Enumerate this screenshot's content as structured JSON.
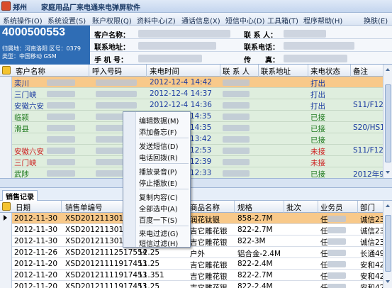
{
  "window": {
    "title": "郑州　　家庭用品厂来电通来电弹屏软件"
  },
  "menu": [
    "系统操作(O)",
    "系统设置(S)",
    "账户权限(Q)",
    "资料中心(Z)",
    "通话信息(X)",
    "短信中心(D)",
    "工具箱(T)",
    "程序帮助(H)",
    "换肤(E)"
  ],
  "caller": {
    "number": "4000500553",
    "location_label": "归属地：",
    "location": "河南洛阳",
    "area_label": "区号：",
    "area_code": "0379",
    "type_label": "类型：",
    "type": "中国移动 GSM"
  },
  "fields": {
    "customer_name": "客户名称：",
    "contact": "联 系 人：",
    "contact_address": "联系地址：",
    "contact_phone": "联系电话：",
    "mobile": "手 机 号：",
    "fax": "传　　真："
  },
  "top_columns": [
    "客户名称",
    "呼入号码",
    "来电时间",
    "联 系 人",
    "联系地址",
    "来电状态",
    "备注"
  ],
  "calls": [
    {
      "name": "栾川",
      "time": "2012-12-4 14:42",
      "status": "打出",
      "note": "",
      "name_color": "blue",
      "status_color": "blue",
      "selected": true
    },
    {
      "name": "三门峡",
      "time": "2012-12-4 14:37",
      "status": "打出",
      "note": "",
      "name_color": "blue",
      "status_color": "blue",
      "selected": false
    },
    {
      "name": "安徽六安",
      "time": "2012-12-4 14:36",
      "status": "打出",
      "note": "S11/F120",
      "name_color": "blue",
      "status_color": "blue",
      "selected": false
    },
    {
      "name": "临颍",
      "time": "14:35",
      "status": "已接",
      "note": "",
      "name_color": "green",
      "status_color": "green",
      "selected": false
    },
    {
      "name": "滑县",
      "time": "14:35",
      "status": "已接",
      "note": "S20/HS14",
      "name_color": "green",
      "status_color": "green",
      "selected": false
    },
    {
      "name": "",
      "time": "13:42",
      "status": "已接",
      "note": "",
      "name_color": "green",
      "status_color": "green",
      "selected": false
    },
    {
      "name": "安徽六安",
      "time": "12:53",
      "status": "未接",
      "note": "S11/F120",
      "name_color": "red",
      "status_color": "red",
      "selected": false
    },
    {
      "name": "三门峡",
      "time": "12:39",
      "status": "未接",
      "note": "",
      "name_color": "red",
      "status_color": "red",
      "selected": false
    },
    {
      "name": "武陟",
      "time": "12:33",
      "status": "已接",
      "note": "2012年9",
      "name_color": "green",
      "status_color": "green",
      "selected": false
    }
  ],
  "tab": {
    "label": "销售记录"
  },
  "sales_columns": [
    "日期",
    "销售单编号",
    "",
    "商品名称",
    "规格",
    "批次",
    "业务员",
    "部门"
  ],
  "sales": [
    {
      "date": "2012-11-30",
      "no": "XSD20121130176",
      "qty": "",
      "product": "润花钛银",
      "spec": "858-2.7M",
      "clerk": "任",
      "dept": "诚信23",
      "selected": true
    },
    {
      "date": "2012-11-30",
      "no": "XSD20121130176",
      "qty": "",
      "product": "吉它雕花银",
      "spec": "822-2.7M",
      "clerk": "任",
      "dept": "诚信23",
      "selected": false
    },
    {
      "date": "2012-11-30",
      "no": "XSD20121130176",
      "qty": "",
      "product": "吉它雕花银",
      "spec": "822-3M",
      "clerk": "任",
      "dept": "诚信23",
      "selected": false
    },
    {
      "date": "2012-11-26",
      "no": "XSD20121112517554",
      "qty": "12.25",
      "product": "户外",
      "spec": "铝合金-2.4M",
      "clerk": "任",
      "dept": "长通49",
      "selected": false
    },
    {
      "date": "2012-11-20",
      "no": "XSD20121111917453",
      "qty": "11.25",
      "product": "吉它雕花银",
      "spec": "822-2.4M",
      "clerk": "任",
      "dept": "安和42",
      "selected": false
    },
    {
      "date": "2012-11-20",
      "no": "XSD20121111917453",
      "qty": "11.351",
      "product": "吉它雕花银",
      "spec": "822-2.7M",
      "clerk": "任",
      "dept": "安和42",
      "selected": false
    },
    {
      "date": "2012-11-20",
      "no": "XSD20121111917453",
      "qty": "11.25",
      "product": "吉它雕花银",
      "spec": "822-2.4M",
      "clerk": "任",
      "dept": "安和42",
      "selected": false
    }
  ],
  "context_menu": [
    "编辑数据(M)",
    "添加备忘(F)",
    "发送短信(D)",
    "电话回拨(R)",
    "播放录音(P)",
    "停止播放(E)",
    "复制内容(C)",
    "全部选中(A)",
    "百度一下(S)",
    "来电过滤(G)",
    "短信过滤(H)"
  ]
}
